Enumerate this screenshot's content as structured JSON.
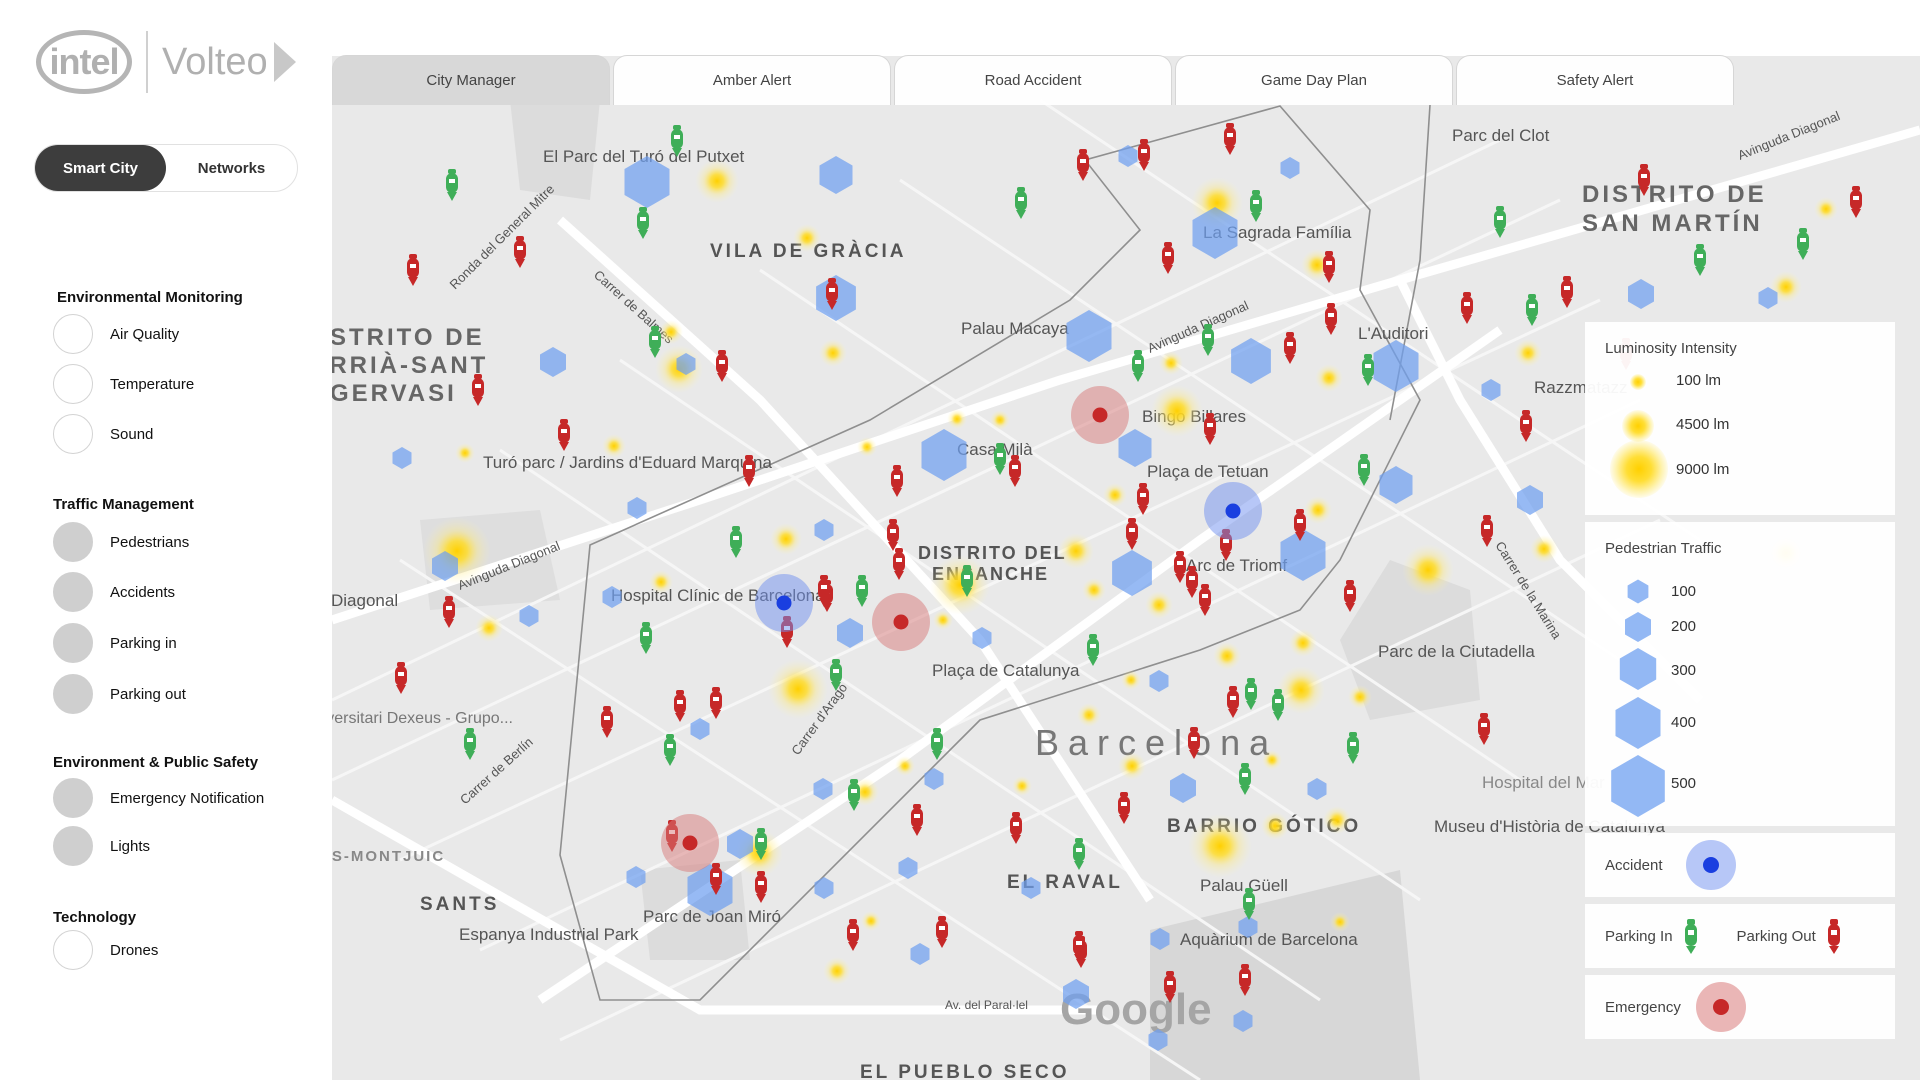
{
  "brand": {
    "intel": "intel",
    "volteo": "Volteo"
  },
  "mode_toggle": {
    "smart_city": "Smart City",
    "networks": "Networks",
    "active": "smart_city"
  },
  "sidebar": {
    "environmental": {
      "title": "Environmental Monitoring",
      "items": [
        "Air Quality",
        "Temperature",
        "Sound"
      ]
    },
    "traffic": {
      "title": "Traffic Management",
      "items": [
        "Pedestrians",
        "Accidents",
        "Parking in",
        "Parking out"
      ]
    },
    "safety": {
      "title": "Environment & Public Safety",
      "items": [
        "Emergency Notification",
        "Lights"
      ]
    },
    "technology": {
      "title": "Technology",
      "items": [
        "Drones"
      ]
    }
  },
  "tabs": [
    "City Manager",
    "Amber Alert",
    "Road Accident",
    "Game Day Plan",
    "Safety Alert"
  ],
  "active_tab": 0,
  "legend": {
    "luminosity": {
      "title": "Luminosity Intensity",
      "levels": [
        "100 lm",
        "4500 lm",
        "9000 lm"
      ]
    },
    "pedestrian": {
      "title": "Pedestrian Traffic",
      "levels": [
        "100",
        "200",
        "300",
        "400",
        "500"
      ]
    },
    "accident": "Accident",
    "parking_in": "Parking In",
    "parking_out": "Parking Out",
    "emergency": "Emergency"
  },
  "map_labels": {
    "vila_gracia": "VILA DE GRÀCIA",
    "sarria_1": "DISTRITO DE",
    "sarria_2": "SARRIÀ-SANT",
    "sarria_3": "GERVASI",
    "eixample_1": "DISTRITO DEL",
    "eixample_2": "ENSANCHE",
    "sant_marti_1": "DISTRITO DE",
    "sant_marti_2": "SAN MARTÍN",
    "barcelona": "Barcelona",
    "gotic": "BARRIO GÓTICO",
    "raval": "EL RAVAL",
    "sants": "SANTS",
    "montjuic": "SANTS-MONTJUIC",
    "poble_sec": "EL PUEBLO SECO",
    "parc_turo": "El Parc del Turó del Putxet",
    "sagrada": "La Sagrada Família",
    "palau_macaya": "Palau Macaya",
    "casa_mila": "Casa Milà",
    "bingo": "Bingo Billares",
    "placa_tetuan": "Plaça de Tetuan",
    "arc_triomf": "Arc de Triomf",
    "hospital_clinic": "Hospital Clínic de Barcelona",
    "placa_catalunya": "Plaça de Catalunya",
    "turo_parc": "Turó parc / Jardins d'Eduard Marquina",
    "parc_ciutadella": "Parc de la Ciutadella",
    "parc_clot": "Parc del Clot",
    "auditori": "L'Auditori",
    "razzmatazz": "Razzmatazz",
    "museu": "Museu d'Història de Catalunya",
    "palau_guell": "Palau Güell",
    "aquarium": "Aquàrium de Barcelona",
    "parc_miro": "Parc de Joan Miró",
    "espanya": "Espanya Industrial Park",
    "hospital_univ": "Hospital Universitari Dexeus - Grupo...",
    "hospital_mar": "Hospital del Mar",
    "diagonal": "Diagonal",
    "google": "Google",
    "av_diagonal": "Avinguda Diagonal",
    "carrer_arago": "Carrer d'Aragó",
    "carrer_balmes": "Carrer de Balmes",
    "carrer_berlin": "Carrer de Berlín",
    "carrer_marina": "Carrer de la Marina",
    "ronda_mitre": "Ronda del General Mitre",
    "av_parallel": "Av. del Paral·lel"
  },
  "colors": {
    "accent_dark": "#3d3d3d",
    "pedestrian_hex": "#6fa0f0",
    "accident": "#1a3fe0",
    "emergency": "#c62828",
    "parking_in": "#3fae58",
    "parking_out": "#c62828",
    "light": "#ffd200"
  }
}
